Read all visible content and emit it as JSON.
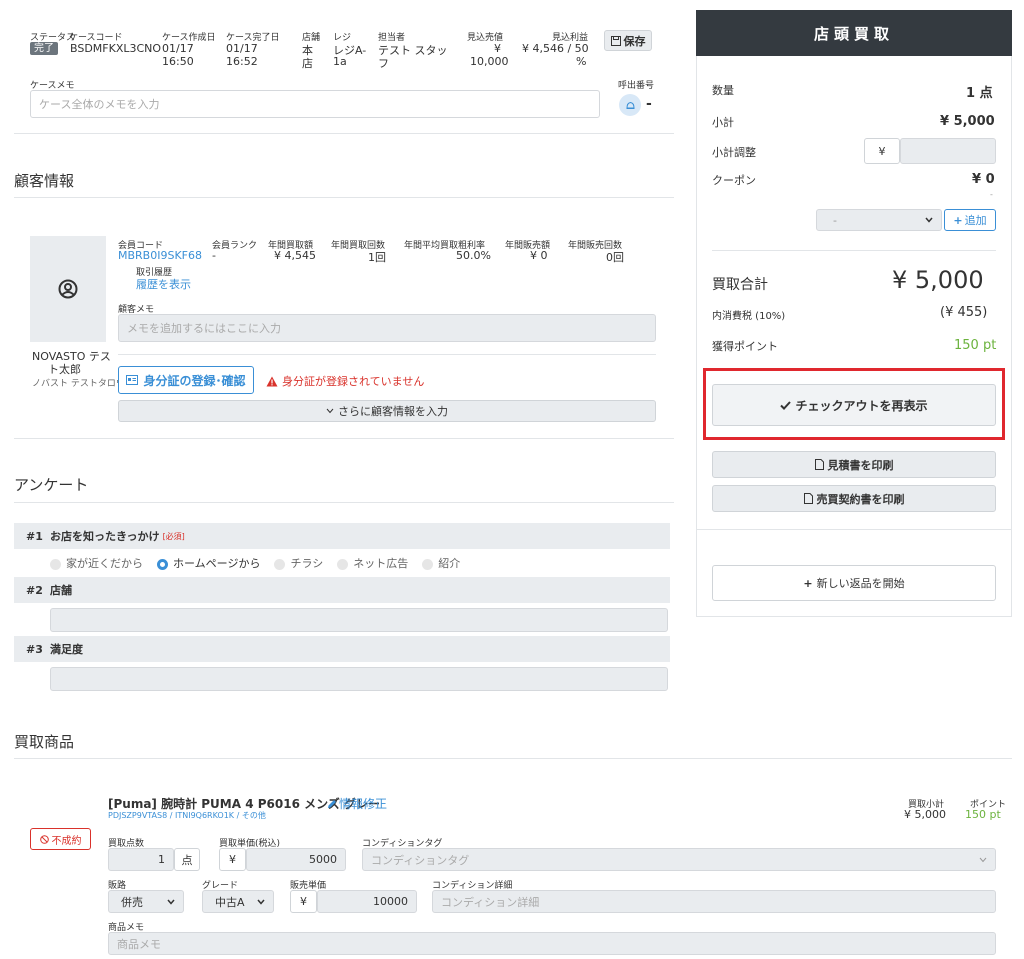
{
  "case_header": {
    "status_label": "ステータス",
    "status_badge": "完了",
    "case_code_label": "ケースコード",
    "case_code": "BSDMFKXL3CNO",
    "created_label": "ケース作成日",
    "created_date": "01/17",
    "created_time": "16:50",
    "completed_label": "ケース完了日",
    "completed_date": "01/17",
    "completed_time": "16:52",
    "store_label": "店舗",
    "store_l1": "本",
    "store_l2": "店",
    "register_label": "レジ",
    "register_l1": "レジA-",
    "register_l2": "1a",
    "staff_label": "担当者",
    "staff_l1": "テスト スタッ",
    "staff_l2": "フ",
    "est_sales_label": "見込売値",
    "est_sales_l1": "¥",
    "est_sales_l2": "10,000",
    "est_profit_label": "見込利益",
    "est_profit_l1": "¥ 4,546 / 50",
    "est_profit_l2": "%",
    "save_label": "保存",
    "memo_label": "ケースメモ",
    "memo_placeholder": "ケース全体のメモを入力",
    "call_number_label": "呼出番号",
    "call_number": "-"
  },
  "customer": {
    "section_title": "顧客情報",
    "name_l1": "NOVASTO テス",
    "name_l2": "ト太郎",
    "kana": "ノバスト テストタロウ",
    "member_code_label": "会員コード",
    "member_code": "MBRB0I9SKF68",
    "history_label": "取引履歴",
    "history_link": "履歴を表示",
    "rank_label": "会員ランク",
    "rank": "-",
    "annual_buy_label": "年間買取額",
    "annual_buy": "¥ 4,545",
    "annual_buy_count_label": "年間買取回数",
    "annual_buy_count": "1回",
    "avg_margin_label": "年間平均買取粗利率",
    "avg_margin": "50.0%",
    "annual_sales_label": "年間販売額",
    "annual_sales": "¥ 0",
    "annual_sales_count_label": "年間販売回数",
    "annual_sales_count": "0回",
    "memo_label": "顧客メモ",
    "memo_placeholder": "メモを追加するにはここに入力",
    "id_button": "身分証の登録･確認",
    "id_warning": "身分証が登録されていません",
    "more_button": "さらに顧客情報を入力"
  },
  "survey": {
    "section_title": "アンケート",
    "q1_num": "#1",
    "q1_label": "お店を知ったきっかけ",
    "q1_required": "[必須]",
    "q1_options": [
      "家が近くだから",
      "ホームページから",
      "チラシ",
      "ネット広告",
      "紹介"
    ],
    "q2_num": "#2",
    "q2_label": "店舗",
    "q3_num": "#3",
    "q3_label": "満足度"
  },
  "items": {
    "section_title": "買取商品",
    "status_badge": "不成約",
    "product_name": "[Puma] 腕時計 PUMA 4 P6016 メンズ グレー",
    "edit_link": "情報修正",
    "product_codes": "PDJSZP9VTAS8 / ITNI9Q6RKO1K / その他",
    "subtotal_label": "買取小計",
    "subtotal": "¥ 5,000",
    "points_label": "ポイント",
    "points": "150 pt",
    "qty_label": "買取点数",
    "qty": "1",
    "qty_unit": "点",
    "unit_price_label": "買取単価(税込)",
    "yen": "¥",
    "unit_price": "5000",
    "condition_tag_label": "コンディションタグ",
    "condition_tag_placeholder": "コンディションタグ",
    "channel_label": "販路",
    "channel": "併売",
    "grade_label": "グレード",
    "grade": "中古A",
    "sale_price_label": "販売単価",
    "sale_price": "10000",
    "condition_detail_label": "コンディション詳細",
    "condition_detail_placeholder": "コンディション詳細",
    "memo_label": "商品メモ",
    "memo_placeholder": "商品メモ"
  },
  "summary": {
    "header": "店頭買取",
    "qty_label": "数量",
    "qty": "1 点",
    "subtotal_label": "小計",
    "subtotal": "¥ 5,000",
    "adjust_label": "小計調整",
    "adjust_yen": "¥",
    "coupon_label": "クーポン",
    "coupon": "¥ 0",
    "coupon_dash": "-",
    "coupon_select": "-",
    "add_button": "追加",
    "total_label": "買取合計",
    "total": "¥ 5,000",
    "tax_label": "内消費税 (10%)",
    "tax": "(¥ 455)",
    "points_label": "獲得ポイント",
    "points": "150 pt",
    "checkout_button": "チェックアウトを再表示",
    "estimate_button": "見積書を印刷",
    "contract_button": "売買契約書を印刷",
    "return_button": "新しい返品を開始"
  },
  "colors": {
    "accent": "#3a8fd6",
    "dark_header": "#343a40",
    "highlight_red": "#e0282e",
    "green": "#6cb33e",
    "warning_red": "#d9322b"
  }
}
